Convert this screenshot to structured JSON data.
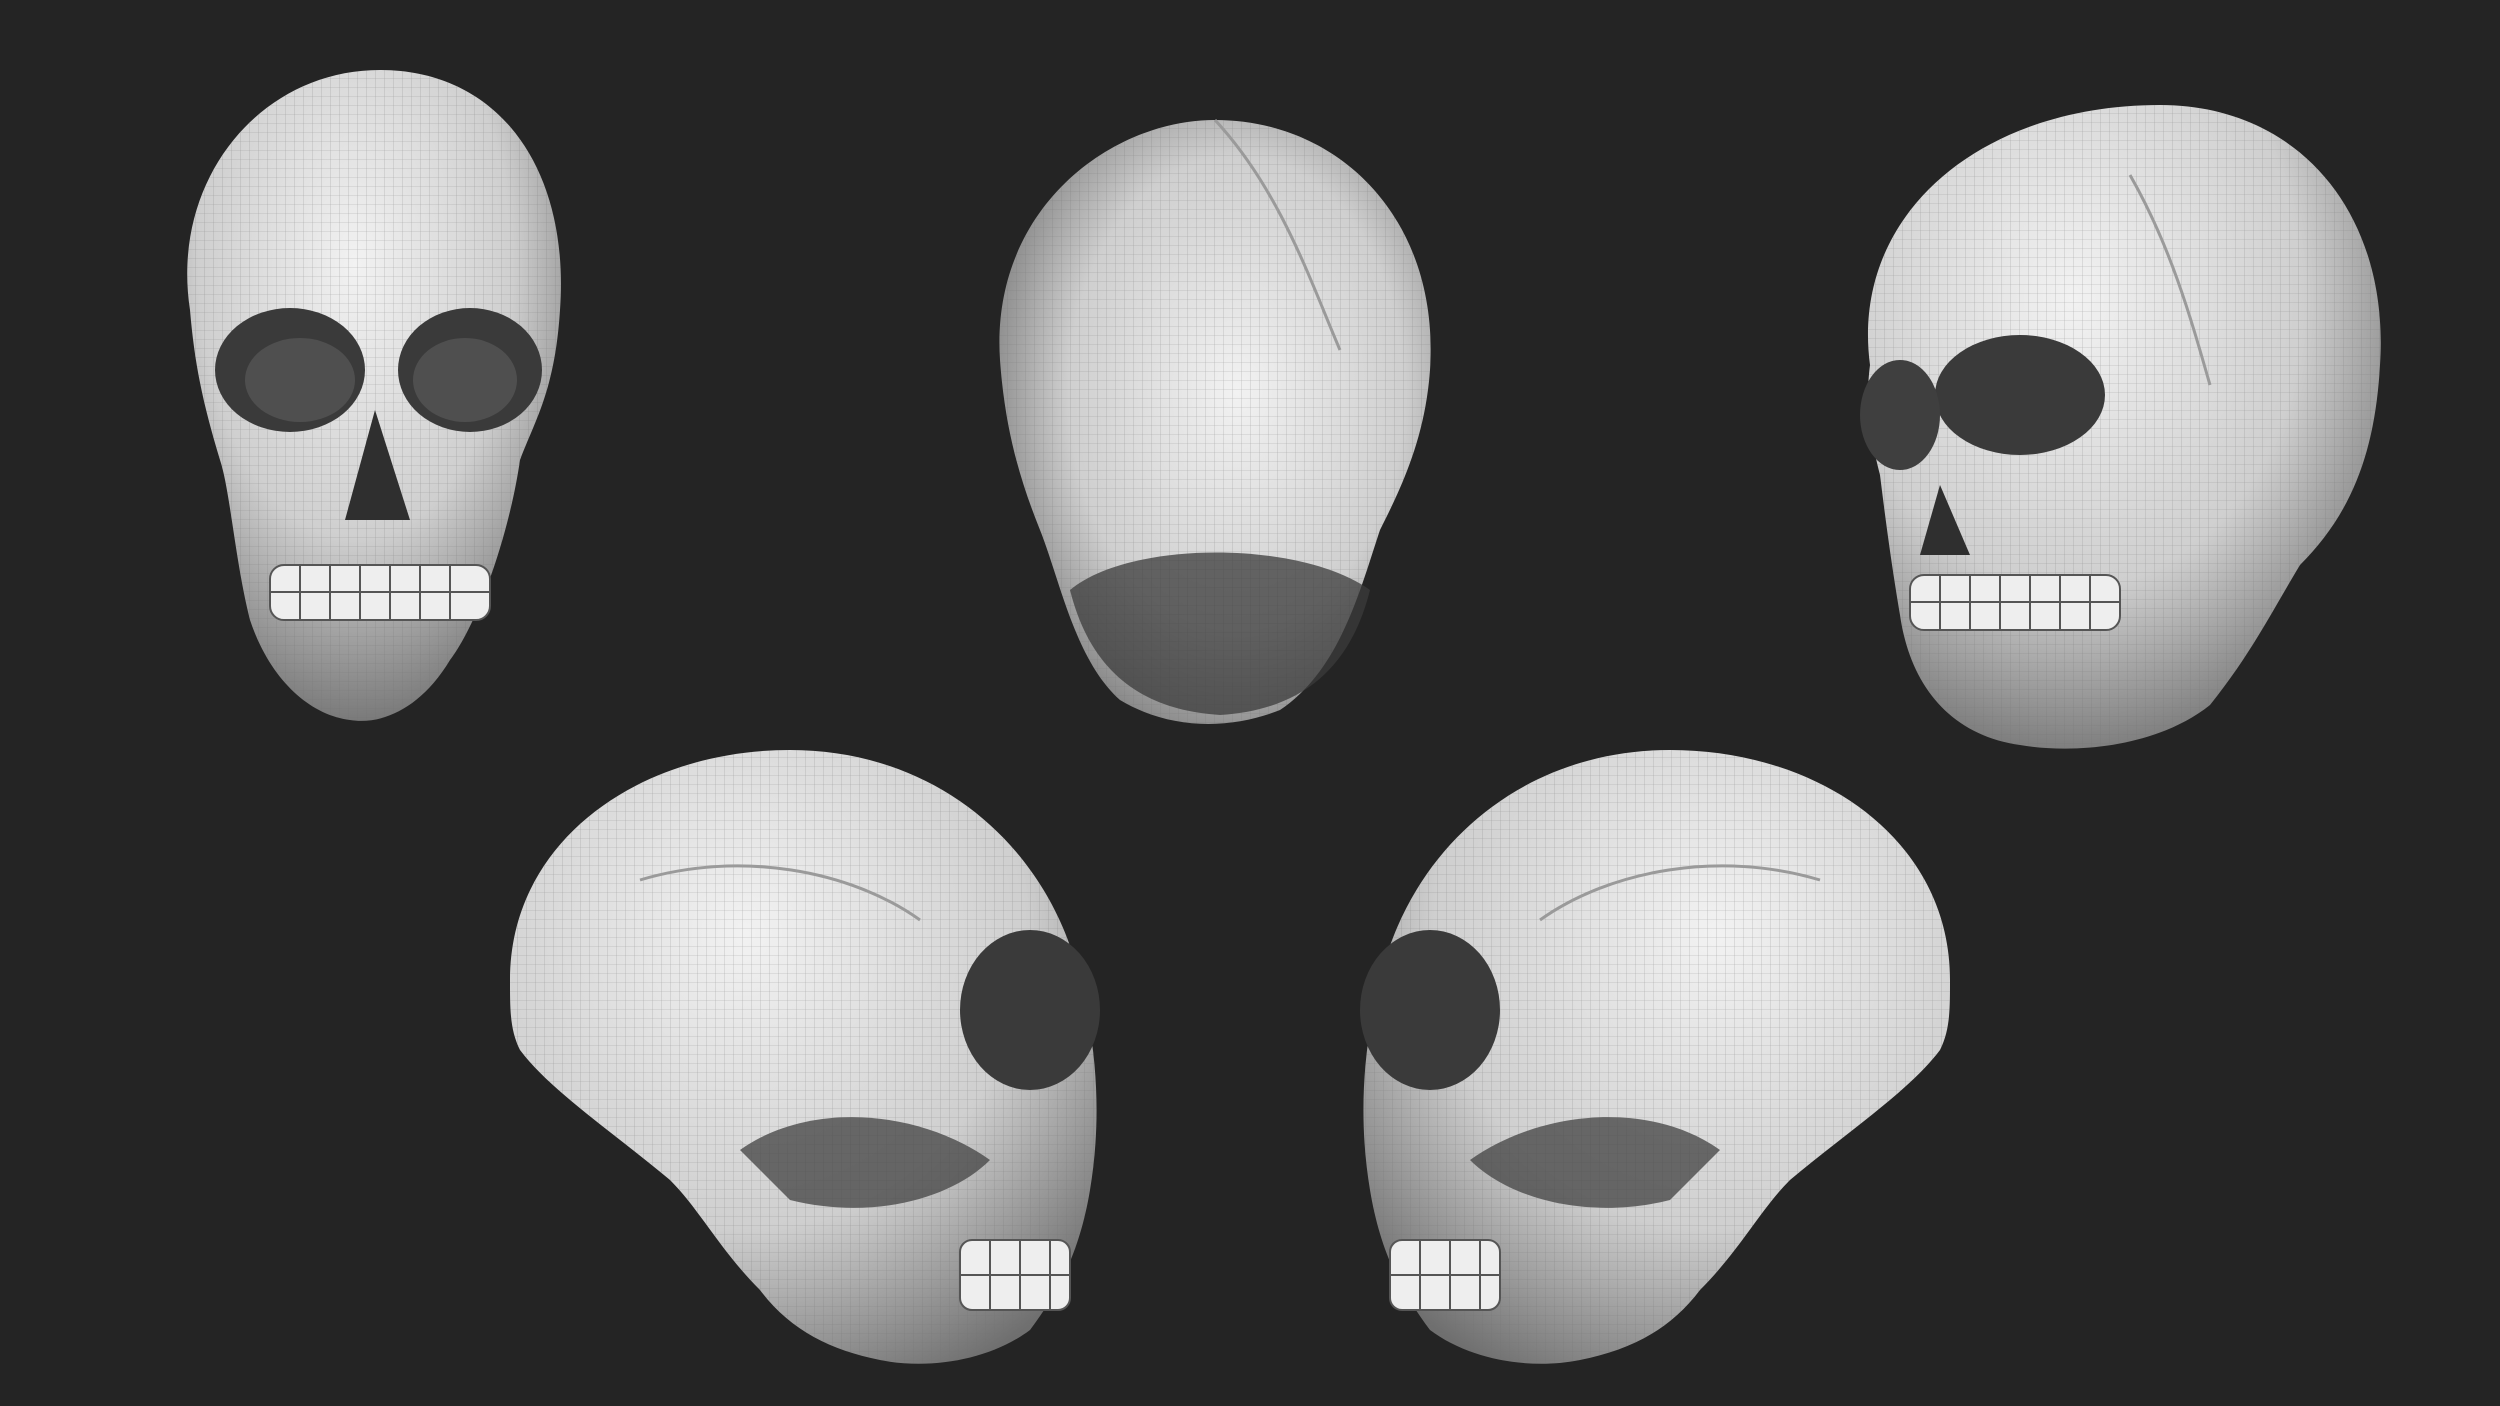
{
  "scene": {
    "background_color": "#242424",
    "object": "skull",
    "views": [
      {
        "id": "front",
        "name": "skull-front-view",
        "icon": "skull-icon"
      },
      {
        "id": "back",
        "name": "skull-back-view",
        "icon": "skull-icon"
      },
      {
        "id": "three-quarter",
        "name": "skull-three-quarter-view",
        "icon": "skull-icon"
      },
      {
        "id": "left-profile",
        "name": "skull-left-profile-view",
        "icon": "skull-icon"
      },
      {
        "id": "right-profile",
        "name": "skull-right-profile-view",
        "icon": "skull-icon"
      }
    ],
    "material": {
      "base_color": "#d9d9d9",
      "highlight_color": "#f2f2f2",
      "shadow_color": "#3a3a3a",
      "wireframe_color": "#6e6e6e"
    }
  }
}
